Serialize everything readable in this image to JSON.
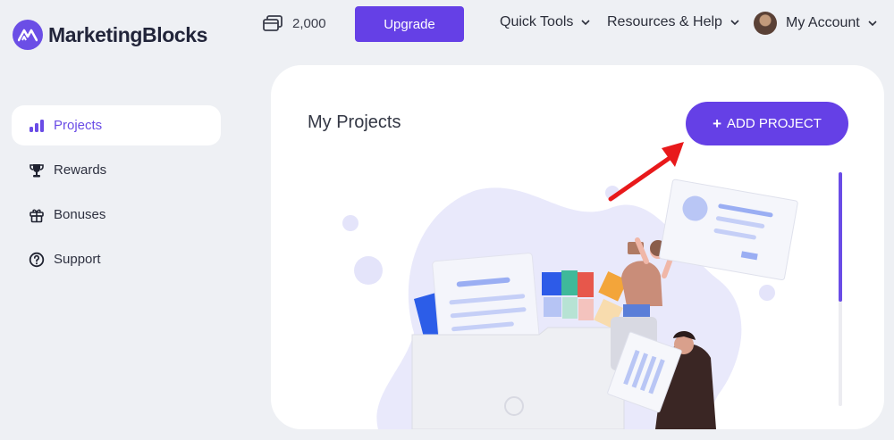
{
  "brand": {
    "name": "MarketingBlocks"
  },
  "header": {
    "credits": "2,000",
    "upgrade_label": "Upgrade",
    "menus": {
      "quick_tools": "Quick Tools",
      "resources": "Resources & Help",
      "account": "My Account"
    }
  },
  "sidebar": {
    "items": [
      {
        "label": "Projects",
        "icon": "bar-chart-icon",
        "active": true
      },
      {
        "label": "Rewards",
        "icon": "trophy-icon",
        "active": false
      },
      {
        "label": "Bonuses",
        "icon": "gift-icon",
        "active": false
      },
      {
        "label": "Support",
        "icon": "help-circle-icon",
        "active": false
      }
    ]
  },
  "main": {
    "title": "My Projects",
    "add_label": "ADD PROJECT"
  },
  "colors": {
    "accent": "#6540e6",
    "background": "#eef0f4",
    "annotation_arrow": "#e8191b"
  }
}
